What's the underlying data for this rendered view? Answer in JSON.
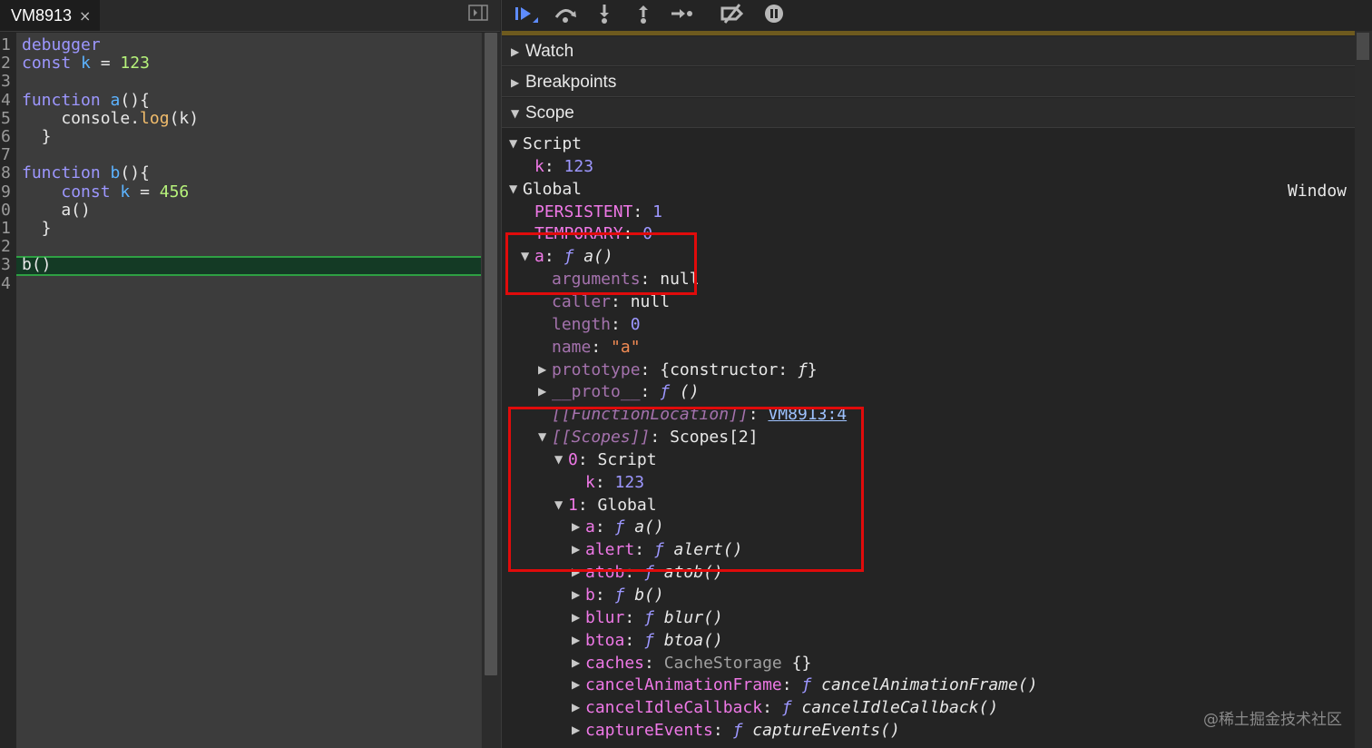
{
  "tab": {
    "title": "VM8913",
    "close": "×"
  },
  "editor": {
    "gutter": [
      "1",
      "2",
      "3",
      "4",
      "5",
      "6",
      "7",
      "8",
      "9",
      "0",
      "1",
      "2",
      "3",
      "4"
    ],
    "lines": [
      [
        {
          "t": "debugger",
          "c": "kw"
        }
      ],
      [
        {
          "t": "const",
          "c": "kw"
        },
        {
          "t": " "
        },
        {
          "t": "k",
          "c": "id"
        },
        {
          "t": " = "
        },
        {
          "t": "123",
          "c": "num"
        }
      ],
      [],
      [
        {
          "t": "function",
          "c": "kw"
        },
        {
          "t": " "
        },
        {
          "t": "a",
          "c": "id"
        },
        {
          "t": "(){"
        }
      ],
      [
        {
          "t": "    console."
        },
        {
          "t": "log",
          "c": "fn"
        },
        {
          "t": "(k)"
        }
      ],
      [
        {
          "t": "  }"
        }
      ],
      [],
      [
        {
          "t": "function",
          "c": "kw"
        },
        {
          "t": " "
        },
        {
          "t": "b",
          "c": "id"
        },
        {
          "t": "(){"
        }
      ],
      [
        {
          "t": "    "
        },
        {
          "t": "const",
          "c": "kw"
        },
        {
          "t": " "
        },
        {
          "t": "k",
          "c": "id"
        },
        {
          "t": " = "
        },
        {
          "t": "456",
          "c": "num"
        }
      ],
      [
        {
          "t": "    a()"
        }
      ],
      [
        {
          "t": "  }"
        }
      ],
      [],
      [
        {
          "t": "b()"
        }
      ],
      []
    ],
    "execution_line": 13
  },
  "toolbar": {
    "buttons": [
      "resume-icon",
      "step-over-icon",
      "step-into-icon",
      "step-out-icon",
      "step-icon",
      "deactivate-breakpoints-icon",
      "pause-on-exceptions-icon"
    ]
  },
  "sections": {
    "watch": "Watch",
    "breakpoints": "Breakpoints",
    "scope": "Scope"
  },
  "scope": {
    "window_label": "Window",
    "rows": [
      {
        "indent": 0,
        "arrow": "down",
        "parts": [
          {
            "t": "Script",
            "c": "val"
          }
        ]
      },
      {
        "indent": 1,
        "arrow": "none",
        "parts": [
          {
            "t": "k",
            "c": "key"
          },
          {
            "t": ": ",
            "c": "sep"
          },
          {
            "t": "123",
            "c": "nv"
          }
        ]
      },
      {
        "indent": 0,
        "arrow": "down",
        "parts": [
          {
            "t": "Global",
            "c": "val"
          }
        ]
      },
      {
        "indent": 1,
        "arrow": "none",
        "parts": [
          {
            "t": "PERSISTENT",
            "c": "key"
          },
          {
            "t": ": ",
            "c": "sep"
          },
          {
            "t": "1",
            "c": "nv"
          }
        ]
      },
      {
        "indent": 1,
        "arrow": "none",
        "parts": [
          {
            "t": "TEMPORARY",
            "c": "key"
          },
          {
            "t": ": ",
            "c": "sep"
          },
          {
            "t": "0",
            "c": "nv"
          }
        ]
      },
      {
        "indent": 1,
        "arrow": "down",
        "parts": [
          {
            "t": "a",
            "c": "key"
          },
          {
            "t": ": ",
            "c": "sep"
          },
          {
            "t": "ƒ",
            "c": "f"
          },
          {
            "t": " a()",
            "c": "it"
          }
        ]
      },
      {
        "indent": 2,
        "arrow": "none",
        "parts": [
          {
            "t": "arguments",
            "c": "keyd"
          },
          {
            "t": ": ",
            "c": "sep"
          },
          {
            "t": "null",
            "c": "val"
          }
        ]
      },
      {
        "indent": 2,
        "arrow": "none",
        "parts": [
          {
            "t": "caller",
            "c": "keyd"
          },
          {
            "t": ": ",
            "c": "sep"
          },
          {
            "t": "null",
            "c": "val"
          }
        ]
      },
      {
        "indent": 2,
        "arrow": "none",
        "parts": [
          {
            "t": "length",
            "c": "keyd"
          },
          {
            "t": ": ",
            "c": "sep"
          },
          {
            "t": "0",
            "c": "nv"
          }
        ]
      },
      {
        "indent": 2,
        "arrow": "none",
        "parts": [
          {
            "t": "name",
            "c": "keyd"
          },
          {
            "t": ": ",
            "c": "sep"
          },
          {
            "t": "\"a\"",
            "c": "str"
          }
        ]
      },
      {
        "indent": 2,
        "arrow": "right",
        "parts": [
          {
            "t": "prototype",
            "c": "keyd"
          },
          {
            "t": ": ",
            "c": "sep"
          },
          {
            "t": "{constructor: ",
            "c": "val"
          },
          {
            "t": "ƒ",
            "c": "it"
          },
          {
            "t": "}",
            "c": "val"
          }
        ]
      },
      {
        "indent": 2,
        "arrow": "right",
        "parts": [
          {
            "t": "__proto__",
            "c": "keyd"
          },
          {
            "t": ": ",
            "c": "sep"
          },
          {
            "t": "ƒ",
            "c": "f"
          },
          {
            "t": " ()",
            "c": "it"
          }
        ]
      },
      {
        "indent": 2,
        "arrow": "none",
        "parts": [
          {
            "t": "[[FunctionLocation]]",
            "c": "keyd-it"
          },
          {
            "t": ": ",
            "c": "sep"
          },
          {
            "t": "VM8913:4",
            "c": "link"
          }
        ]
      },
      {
        "indent": 2,
        "arrow": "down",
        "parts": [
          {
            "t": "[[Scopes]]",
            "c": "keyd-it"
          },
          {
            "t": ": ",
            "c": "sep"
          },
          {
            "t": "Scopes[2]",
            "c": "val"
          }
        ]
      },
      {
        "indent": 3,
        "arrow": "down",
        "parts": [
          {
            "t": "0",
            "c": "key"
          },
          {
            "t": ": ",
            "c": "sep"
          },
          {
            "t": "Script",
            "c": "val"
          }
        ]
      },
      {
        "indent": 4,
        "arrow": "none",
        "parts": [
          {
            "t": "k",
            "c": "key"
          },
          {
            "t": ": ",
            "c": "sep"
          },
          {
            "t": "123",
            "c": "nv"
          }
        ]
      },
      {
        "indent": 3,
        "arrow": "down",
        "parts": [
          {
            "t": "1",
            "c": "key"
          },
          {
            "t": ": ",
            "c": "sep"
          },
          {
            "t": "Global",
            "c": "val"
          }
        ]
      },
      {
        "indent": 4,
        "arrow": "right",
        "parts": [
          {
            "t": "a",
            "c": "key"
          },
          {
            "t": ": ",
            "c": "sep"
          },
          {
            "t": "ƒ",
            "c": "f"
          },
          {
            "t": " a()",
            "c": "it"
          }
        ]
      },
      {
        "indent": 4,
        "arrow": "right",
        "parts": [
          {
            "t": "alert",
            "c": "key"
          },
          {
            "t": ": ",
            "c": "sep"
          },
          {
            "t": "ƒ",
            "c": "f"
          },
          {
            "t": " alert()",
            "c": "it"
          }
        ]
      },
      {
        "indent": 4,
        "arrow": "right",
        "parts": [
          {
            "t": "atob",
            "c": "key"
          },
          {
            "t": ": ",
            "c": "sep"
          },
          {
            "t": "ƒ",
            "c": "f"
          },
          {
            "t": " atob()",
            "c": "it"
          }
        ]
      },
      {
        "indent": 4,
        "arrow": "right",
        "parts": [
          {
            "t": "b",
            "c": "key"
          },
          {
            "t": ": ",
            "c": "sep"
          },
          {
            "t": "ƒ",
            "c": "f"
          },
          {
            "t": " b()",
            "c": "it"
          }
        ]
      },
      {
        "indent": 4,
        "arrow": "right",
        "parts": [
          {
            "t": "blur",
            "c": "key"
          },
          {
            "t": ": ",
            "c": "sep"
          },
          {
            "t": "ƒ",
            "c": "f"
          },
          {
            "t": " blur()",
            "c": "it"
          }
        ]
      },
      {
        "indent": 4,
        "arrow": "right",
        "parts": [
          {
            "t": "btoa",
            "c": "key"
          },
          {
            "t": ": ",
            "c": "sep"
          },
          {
            "t": "ƒ",
            "c": "f"
          },
          {
            "t": " btoa()",
            "c": "it"
          }
        ]
      },
      {
        "indent": 4,
        "arrow": "right",
        "parts": [
          {
            "t": "caches",
            "c": "key"
          },
          {
            "t": ": ",
            "c": "sep"
          },
          {
            "t": "CacheStorage",
            "c": "grey"
          },
          {
            "t": " {}",
            "c": "val"
          }
        ]
      },
      {
        "indent": 4,
        "arrow": "right",
        "parts": [
          {
            "t": "cancelAnimationFrame",
            "c": "key"
          },
          {
            "t": ": ",
            "c": "sep"
          },
          {
            "t": "ƒ",
            "c": "f"
          },
          {
            "t": " cancelAnimationFrame()",
            "c": "it"
          }
        ]
      },
      {
        "indent": 4,
        "arrow": "right",
        "parts": [
          {
            "t": "cancelIdleCallback",
            "c": "key"
          },
          {
            "t": ": ",
            "c": "sep"
          },
          {
            "t": "ƒ",
            "c": "f"
          },
          {
            "t": " cancelIdleCallback()",
            "c": "it"
          }
        ]
      },
      {
        "indent": 4,
        "arrow": "right",
        "parts": [
          {
            "t": "captureEvents",
            "c": "key"
          },
          {
            "t": ": ",
            "c": "sep"
          },
          {
            "t": "ƒ",
            "c": "f"
          },
          {
            "t": " captureEvents()",
            "c": "it"
          }
        ]
      }
    ]
  },
  "watermark": "@稀土掘金技术社区",
  "colors": {
    "highlight_box": "#e00b0b",
    "exec_line": "#2ea043",
    "accent": "#5e8cff"
  }
}
